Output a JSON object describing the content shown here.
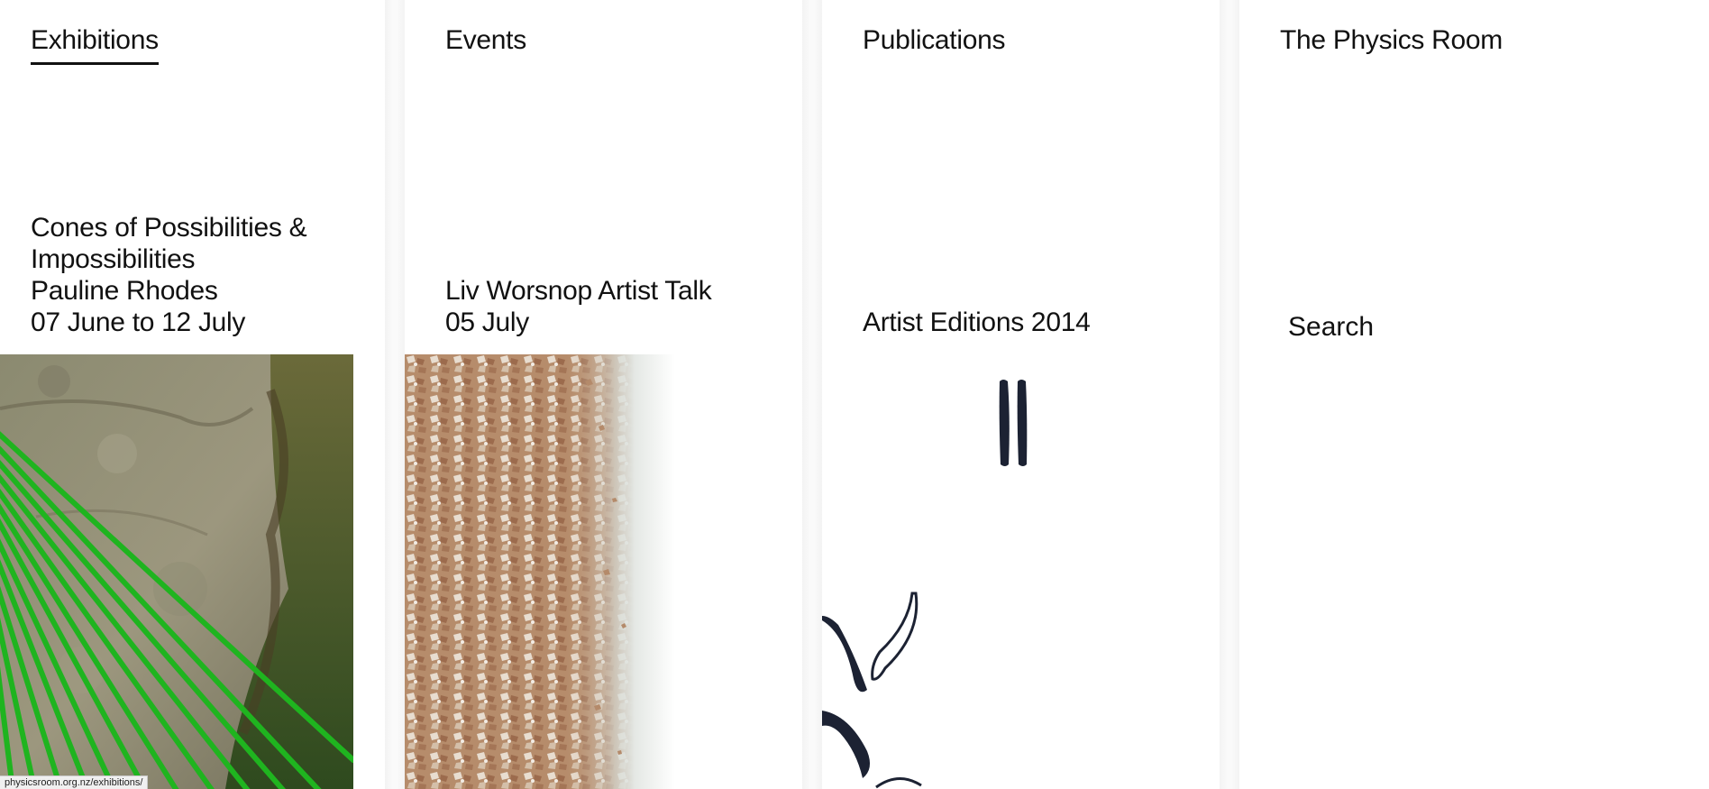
{
  "nav": {
    "exhibitions": "Exhibitions",
    "events": "Events",
    "publications": "Publications",
    "physics_room": "The Physics Room"
  },
  "exhibition": {
    "title_line1": "Cones of Possibilities &",
    "title_line2": "Impossibilities",
    "artist": "Pauline Rhodes",
    "dates": "07 June to 12 July"
  },
  "event": {
    "title": "Liv Worsnop Artist Talk",
    "date": "05 July"
  },
  "publication": {
    "title": "Artist Editions 2014"
  },
  "search_label": "Search",
  "status_bar": {
    "url": "physicsroom.org.nz/exhibitions/"
  },
  "icons": {
    "exhibition_image": "rock-with-green-rods-image",
    "event_image": "crushed-shell-fragments-image",
    "publication_image": "brush-stroke-artwork-image"
  }
}
